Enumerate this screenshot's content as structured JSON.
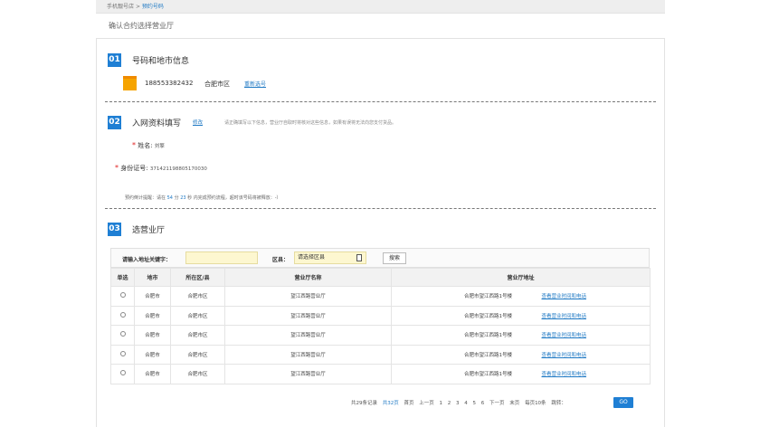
{
  "breadcrumb": {
    "root": "手机靓号店",
    "sep": ">",
    "current": "预约号码"
  },
  "page_title": "确认合约选择营业厅",
  "step1": {
    "badge": "01",
    "title": "号码和地市信息",
    "phone": "18855338243­2",
    "city": "合肥市区",
    "reselect": "重新选号"
  },
  "step2": {
    "badge": "02",
    "title": "入网资料填写",
    "edit": "修改",
    "hint": "请正确填写以下信息，营业厅自取时将核对这些信息，如果有误将无法向您支付货品。",
    "name_label": "姓名:",
    "name_value": "刘擎",
    "id_label": "身份证号:",
    "id_value": "371421198805170030",
    "countdown": {
      "prefix": "预约倒计提醒：请在",
      "minutes": "54",
      "min_unit": "分",
      "seconds": "23",
      "suffix": "秒 内完成预约流程，超时该号码将被释放：-）"
    }
  },
  "step3": {
    "badge": "03",
    "title": "选营业厅",
    "search": {
      "keyword_label": "请输入地址关键字：",
      "keyword_value": "",
      "district_label": "区县：",
      "district_value": "请选择区县",
      "button": "搜索"
    },
    "columns": [
      "单选",
      "地市",
      "所在区/县",
      "营业厅名称",
      "营业厅地址"
    ],
    "rows": [
      {
        "city": "合肥市",
        "district": "合肥市区",
        "hall": "望江西路营业厅",
        "address": "合肥市望江西路1号楼",
        "action": "查看营业时间和电话"
      },
      {
        "city": "合肥市",
        "district": "合肥市区",
        "hall": "望江西路营业厅",
        "address": "合肥市望江西路1号楼",
        "action": "查看营业时间和电话"
      },
      {
        "city": "合肥市",
        "district": "合肥市区",
        "hall": "望江西路营业厅",
        "address": "合肥市望江西路1号楼",
        "action": "查看营业时间和电话"
      },
      {
        "city": "合肥市",
        "district": "合肥市区",
        "hall": "望江西路营业厅",
        "address": "合肥市望江西路1号楼",
        "action": "查看营业时间和电话"
      },
      {
        "city": "合肥市",
        "district": "合肥市区",
        "hall": "望江西路营业厅",
        "address": "合肥市望江西路1号楼",
        "action": "查看营业时间和电话"
      }
    ],
    "pagination": {
      "total": "共29条记录",
      "pages": "共32页",
      "first": "首页",
      "prev": "上一页",
      "nums": [
        "1",
        "2",
        "3",
        "4",
        "5",
        "6"
      ],
      "next": "下一页",
      "last": "末页",
      "per_page": "每页10条",
      "jump": "跳转：",
      "go": "GO"
    }
  },
  "colors": {
    "accent": "#1f7fd4",
    "link": "#1f79c4",
    "required": "#e02020",
    "input_bg": "#fdf7d0"
  }
}
